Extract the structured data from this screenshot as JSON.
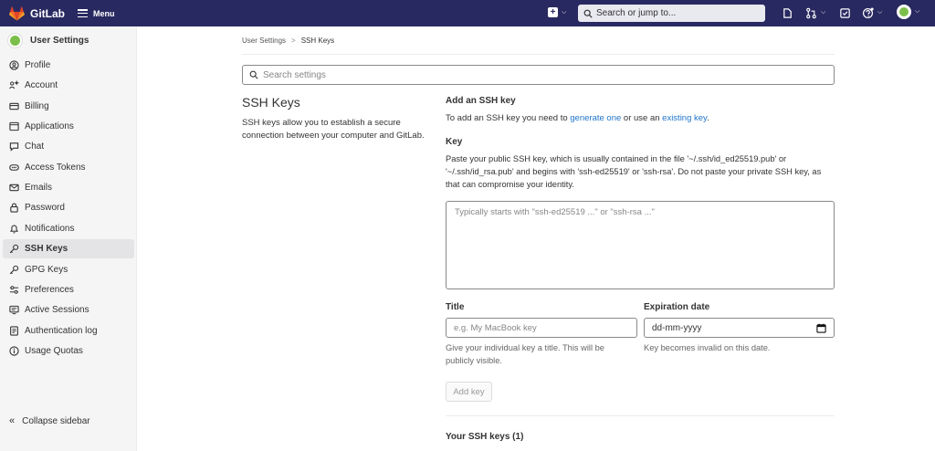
{
  "topbar": {
    "brand": "GitLab",
    "menu_label": "Menu",
    "search_placeholder": "Search or jump to..."
  },
  "sidebar": {
    "title": "User Settings",
    "items": [
      {
        "label": "Profile",
        "icon": "profile-icon"
      },
      {
        "label": "Account",
        "icon": "account-icon"
      },
      {
        "label": "Billing",
        "icon": "billing-icon"
      },
      {
        "label": "Applications",
        "icon": "applications-icon"
      },
      {
        "label": "Chat",
        "icon": "chat-icon"
      },
      {
        "label": "Access Tokens",
        "icon": "token-icon"
      },
      {
        "label": "Emails",
        "icon": "mail-icon"
      },
      {
        "label": "Password",
        "icon": "lock-icon"
      },
      {
        "label": "Notifications",
        "icon": "bell-icon"
      },
      {
        "label": "SSH Keys",
        "icon": "key-icon",
        "active": true
      },
      {
        "label": "GPG Keys",
        "icon": "key-icon"
      },
      {
        "label": "Preferences",
        "icon": "preferences-icon"
      },
      {
        "label": "Active Sessions",
        "icon": "monitor-icon"
      },
      {
        "label": "Authentication log",
        "icon": "log-icon"
      },
      {
        "label": "Usage Quotas",
        "icon": "info-icon"
      }
    ],
    "collapse_label": "Collapse sidebar"
  },
  "breadcrumb": {
    "parent": "User Settings",
    "separator": ">",
    "current": "SSH Keys"
  },
  "settings_search_placeholder": "Search settings",
  "section": {
    "title": "SSH Keys",
    "description": "SSH keys allow you to establish a secure connection between your computer and GitLab."
  },
  "form": {
    "add_title": "Add an SSH key",
    "add_desc_prefix": "To add an SSH key you need to ",
    "generate_link": "generate one",
    "add_desc_middle": " or use an ",
    "existing_link": "existing key",
    "add_desc_suffix": ".",
    "key_label": "Key",
    "key_help": "Paste your public SSH key, which is usually contained in the file '~/.ssh/id_ed25519.pub' or '~/.ssh/id_rsa.pub' and begins with 'ssh-ed25519' or 'ssh-rsa'. Do not paste your private SSH key, as that can compromise your identity.",
    "key_placeholder": "Typically starts with \"ssh-ed25519 ...\" or \"ssh-rsa ...\"",
    "title_label": "Title",
    "title_placeholder": "e.g. My MacBook key",
    "title_help": "Give your individual key a title. This will be publicly visible.",
    "expiration_label": "Expiration date",
    "expiration_value": "dd-mm-yyyy",
    "expiration_help": "Key becomes invalid on this date.",
    "add_button": "Add key"
  },
  "your_keys_title": "Your SSH keys (1)",
  "colors": {
    "topbar": "#292961",
    "link": "#1f75cb",
    "sidebar_bg": "#f5f5f5"
  }
}
